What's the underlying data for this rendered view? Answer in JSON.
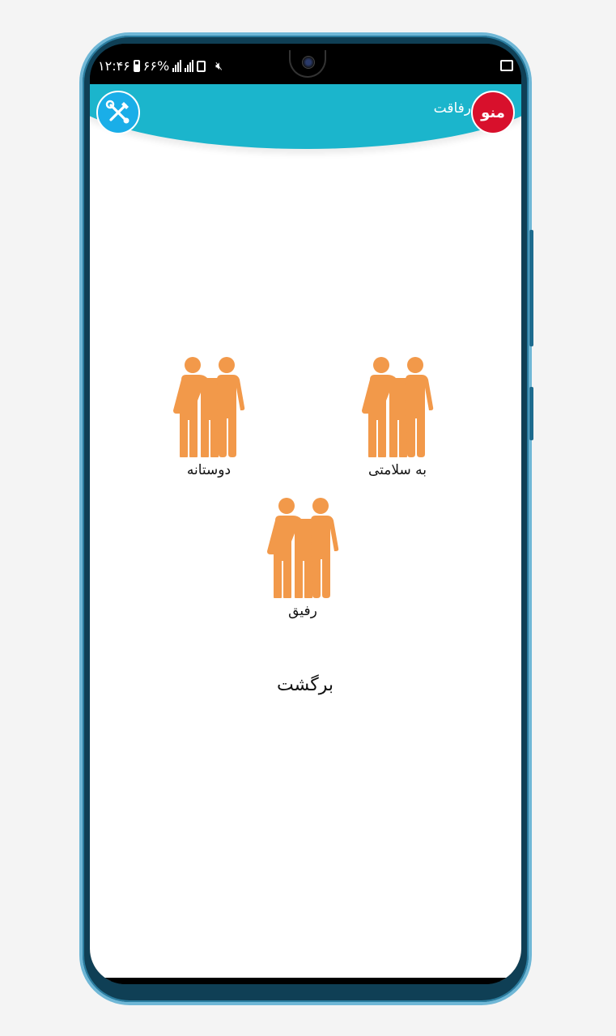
{
  "status_bar": {
    "time": "۱۲:۴۶",
    "battery": "۶۶%",
    "battery_level": 0.66
  },
  "header": {
    "title": "رفاقت",
    "menu_label": "منو",
    "color": "#1bb5cc",
    "menu_color": "#d8102c",
    "tools_color": "#1aaee8"
  },
  "choices": [
    {
      "label": "دوستانه",
      "icon": "two-friends-icon"
    },
    {
      "label": "به سلامتی",
      "icon": "two-friends-icon"
    },
    {
      "label": "رفیق",
      "icon": "two-friends-icon"
    }
  ],
  "icon_color": "#f2994a",
  "back": {
    "label": "برگشت"
  }
}
